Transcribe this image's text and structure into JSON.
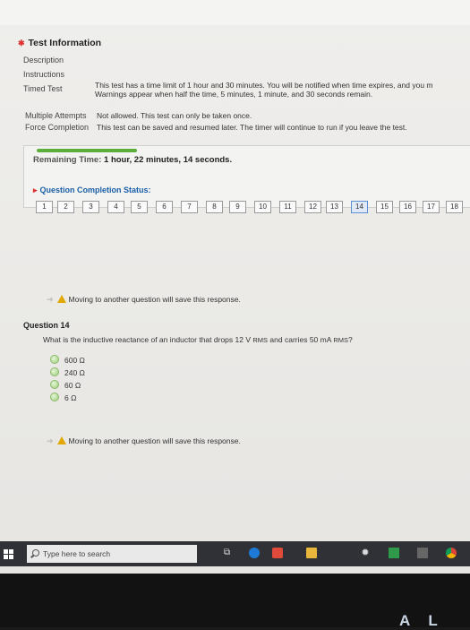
{
  "test_info": {
    "title": "Test Information",
    "labels": {
      "description": "Description",
      "instructions": "Instructions",
      "timed_test": "Timed Test",
      "multiple_attempts": "Multiple Attempts",
      "force_completion": "Force Completion"
    },
    "timed_test_line1": "This test has a time limit of 1 hour and 30 minutes. You will be notified when time expires, and you m",
    "timed_test_line2": "Warnings appear when half the time, 5 minutes, 1 minute, and 30 seconds remain.",
    "multiple_attempts_value": "Not allowed. This test can only be taken once.",
    "force_completion_value": "This test can be saved and resumed later. The timer will continue to run if you leave the test."
  },
  "timer": {
    "label": "Remaining Time:",
    "value": "1 hour, 22 minutes, 14 seconds."
  },
  "completion_status": {
    "label": "Question Completion Status:",
    "questions": [
      "1",
      "2",
      "3",
      "4",
      "5",
      "6",
      "7",
      "8",
      "9",
      "10",
      "11",
      "12",
      "13",
      "14",
      "15",
      "16",
      "17",
      "18"
    ],
    "current": "14"
  },
  "notice_text": "Moving to another question will save this response.",
  "question": {
    "label": "Question 14",
    "text_before": "What is the inductive reactance of an inductor that drops 12 V",
    "sub1": "RMS",
    "text_mid": "and carries 50 mA",
    "sub2": "RMS",
    "text_end": "?",
    "options": [
      "600 Ω",
      "240 Ω",
      "60 Ω",
      "6 Ω"
    ]
  },
  "taskbar": {
    "search_placeholder": "Type here to search",
    "icons": [
      "windows-logo-icon",
      "task-view-icon",
      "edge-browser-icon",
      "red-app-icon",
      "file-explorer-icon",
      "settings-gear-icon",
      "green-app-icon",
      "news-app-icon",
      "chrome-icon"
    ]
  },
  "bottom_text": "A L",
  "colors": {
    "accent_green": "#5cae3a",
    "link_blue": "#1a5ea8",
    "warning_yellow": "#e0a800",
    "taskbar": "#2f3136"
  }
}
